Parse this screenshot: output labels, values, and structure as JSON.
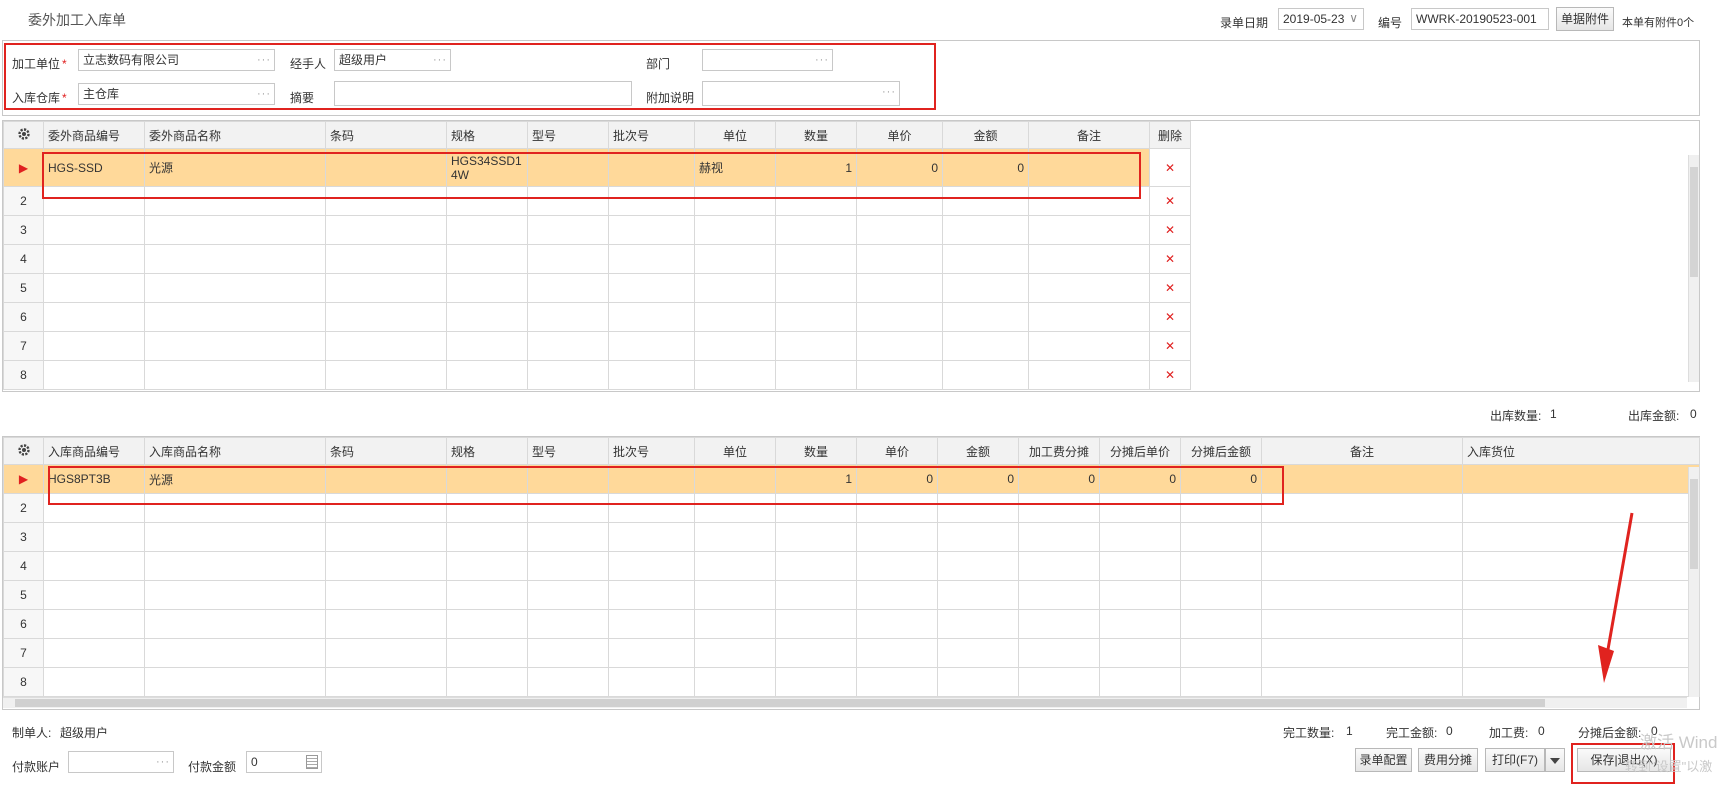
{
  "page_title": "委外加工入库单",
  "header": {
    "date_label": "录单日期",
    "date_value": "2019-05-23",
    "number_label": "编号",
    "number_value": "WWRK-20190523-001",
    "attach_button": "单据附件",
    "attach_count": "本单有附件0个"
  },
  "form": {
    "processor_label": "加工单位",
    "processor_value": "立志数码有限公司",
    "handler_label": "经手人",
    "handler_value": "超级用户",
    "dept_label": "部门",
    "dept_value": "",
    "warehouse_label": "入库仓库",
    "warehouse_value": "主仓库",
    "summary_label": "摘要",
    "summary_value": "",
    "note_label": "附加说明",
    "note_value": "",
    "required_mark": "*"
  },
  "outsource_grid": {
    "settings_icon": "gear-icon",
    "columns": [
      "委外商品编号",
      "委外商品名称",
      "条码",
      "规格",
      "型号",
      "批次号",
      "单位",
      "数量",
      "单价",
      "金额",
      "备注",
      "删除"
    ],
    "rows": [
      {
        "rn": "▶",
        "code": "HGS-SSD",
        "name": "光源",
        "barcode": "",
        "spec": "HGS34SSD14W",
        "model": "",
        "batch": "",
        "unit": "赫视",
        "qty": "1",
        "price": "0",
        "amount": "0",
        "remark": ""
      },
      {
        "rn": "2"
      },
      {
        "rn": "3"
      },
      {
        "rn": "4"
      },
      {
        "rn": "5"
      },
      {
        "rn": "6"
      },
      {
        "rn": "7"
      },
      {
        "rn": "8"
      }
    ],
    "delete_glyph": "✕"
  },
  "out_summary": {
    "qty_label": "出库数量:",
    "qty_value": "1",
    "amount_label": "出库金额:",
    "amount_value": "0"
  },
  "in_grid": {
    "columns": [
      "入库商品编号",
      "入库商品名称",
      "条码",
      "规格",
      "型号",
      "批次号",
      "单位",
      "数量",
      "单价",
      "金额",
      "加工费分摊",
      "分摊后单价",
      "分摊后金额",
      "备注",
      "入库货位"
    ],
    "rows": [
      {
        "rn": "▶",
        "code": "HGS8PT3B",
        "name": "光源",
        "qty": "1",
        "price": "0",
        "amount": "0",
        "fee": "0",
        "unit_after": "0",
        "amount_after": "0"
      },
      {
        "rn": "2"
      },
      {
        "rn": "3"
      },
      {
        "rn": "4"
      },
      {
        "rn": "5"
      },
      {
        "rn": "6"
      },
      {
        "rn": "7"
      },
      {
        "rn": "8"
      }
    ]
  },
  "footer": {
    "maker_label": "制单人:",
    "maker_value": "超级用户",
    "done_qty_label": "完工数量:",
    "done_qty_value": "1",
    "done_amount_label": "完工金额:",
    "done_amount_value": "0",
    "fee_label": "加工费:",
    "fee_value": "0",
    "after_amount_label": "分摊后金额:",
    "after_amount_value": "0",
    "pay_account_label": "付款账户",
    "pay_account_value": "",
    "pay_amount_label": "付款金额",
    "pay_amount_value": "0"
  },
  "buttons": {
    "config": "录单配置",
    "cost_split": "费用分摊",
    "print": "打印(F7)",
    "save_exit": "保存|退出(X)"
  },
  "watermark": {
    "line1": "激活 Wind",
    "line2": "转到\"设置\"以激"
  },
  "colors": {
    "highlight_row": "#ffd99a",
    "annotation_red": "#e0231f"
  }
}
